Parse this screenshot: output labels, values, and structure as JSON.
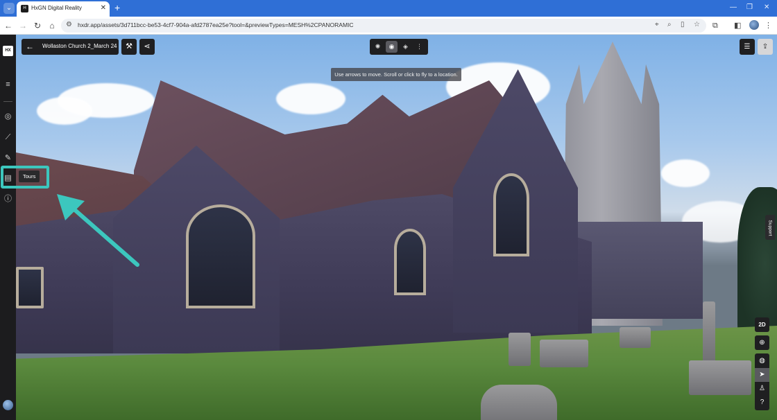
{
  "browser": {
    "tab_title": "HxGN Digital Reality",
    "tab_close": "✕",
    "new_tab": "+",
    "url": "hxdr.app/assets/3d711bcc-be53-4cf7-904a-afd2787ea25e?tool=&previewTypes=MESH%2CPANORAMIC",
    "window_minimize": "—",
    "window_maximize": "❐",
    "window_close": "✕"
  },
  "app": {
    "logo_text": "HX",
    "asset_title": "Wollaston Church 2_March 24",
    "hint": "Use arrows to move. Scroll or click to fly to a location.",
    "tours_label": "Tours",
    "support_label": "Support",
    "view_2d_label": "2D",
    "help_label": "?"
  },
  "colors": {
    "highlight": "#3cc7be",
    "panel_bg": "#1f1f21",
    "browser_accent": "#2f6fd6"
  }
}
